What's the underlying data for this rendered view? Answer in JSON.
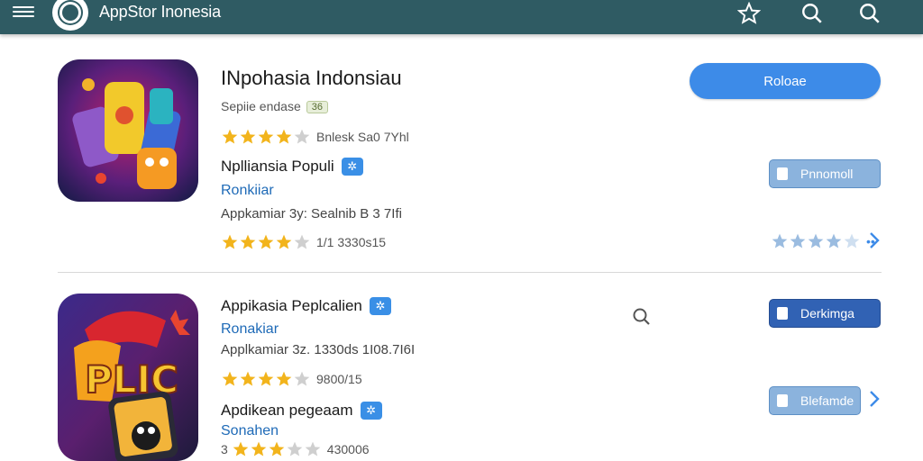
{
  "header": {
    "title": "AppStor Inonesia",
    "icons": [
      "menu-icon",
      "logo-icon",
      "star-icon",
      "search-icon",
      "search-icon"
    ]
  },
  "colors": {
    "header_bg": "#2f5b63",
    "star": "#f2b41c",
    "accent": "#3d8be8",
    "link": "#1e6ab7"
  },
  "apps": [
    {
      "title": "INpohasia Indonsiau",
      "subtitle": "Sepiie endase",
      "tag": "36",
      "rating_text": "Bnlesk Sa0 7Yhl",
      "stars": 4,
      "name": "Nplliansia Populi",
      "link": "Ronkiiar",
      "info": "Appkamiar 3y: Sealnib B 3 7Ifi",
      "rating2_text": "1/1 3330s15",
      "primary_button": "Roloae",
      "secondary_button": "Pnnomoll",
      "side_stars": 4
    },
    {
      "name": "Appikasia Peplcalien",
      "link": "Ronakiar",
      "info": "Applkamiar 3z. 1330ds 1I08.7I6I",
      "rating_text": "9800/15",
      "stars": 4,
      "button": "Derkimga"
    },
    {
      "name": "Apdikean pegeaam",
      "link": "Sonahen",
      "rating_text": "430006",
      "stars_prefix": "3",
      "button": "Blefamde"
    }
  ]
}
